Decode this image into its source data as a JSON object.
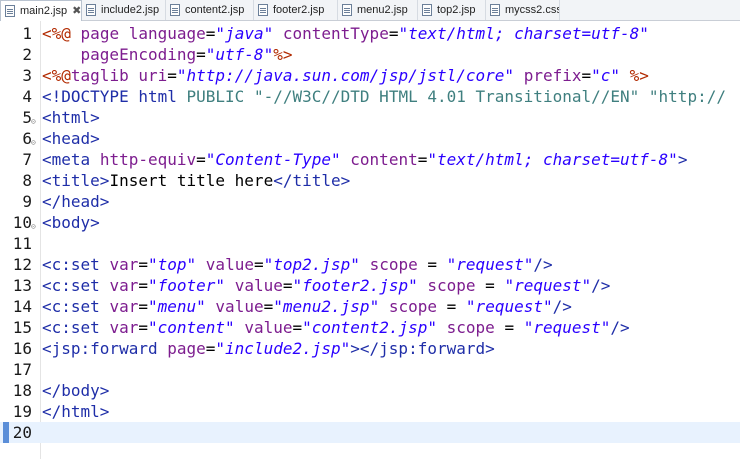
{
  "tabs": [
    {
      "label": "main2.jsp",
      "active": true,
      "closable": true
    },
    {
      "label": "include2.jsp"
    },
    {
      "label": "content2.jsp"
    },
    {
      "label": "footer2.jsp"
    },
    {
      "label": "menu2.jsp"
    },
    {
      "label": "top2.jsp"
    },
    {
      "label": "mycss2.css"
    }
  ],
  "editor": {
    "current_line": 20,
    "lines": [
      {
        "n": "1",
        "fold": false,
        "tokens": [
          [
            "dir",
            "<%@"
          ],
          [
            "plain",
            " "
          ],
          [
            "attr",
            "page"
          ],
          [
            "plain",
            " "
          ],
          [
            "attr",
            "language"
          ],
          [
            "plain",
            "="
          ],
          [
            "str",
            "\"java\""
          ],
          [
            "plain",
            " "
          ],
          [
            "attr",
            "contentType"
          ],
          [
            "plain",
            "="
          ],
          [
            "str",
            "\"text/html; charset=utf-8\""
          ]
        ]
      },
      {
        "n": "2",
        "fold": false,
        "tokens": [
          [
            "plain",
            "    "
          ],
          [
            "attr",
            "pageEncoding"
          ],
          [
            "plain",
            "="
          ],
          [
            "str",
            "\"utf-8\""
          ],
          [
            "dir",
            "%>"
          ]
        ]
      },
      {
        "n": "3",
        "fold": false,
        "tokens": [
          [
            "dir",
            "<%@"
          ],
          [
            "attr",
            "taglib"
          ],
          [
            "plain",
            " "
          ],
          [
            "attr",
            "uri"
          ],
          [
            "plain",
            "="
          ],
          [
            "str",
            "\"http://java.sun.com/jsp/jstl/core\""
          ],
          [
            "plain",
            " "
          ],
          [
            "attr",
            "prefix"
          ],
          [
            "plain",
            "="
          ],
          [
            "str",
            "\"c\""
          ],
          [
            "plain",
            " "
          ],
          [
            "dir",
            "%>"
          ]
        ]
      },
      {
        "n": "4",
        "fold": false,
        "tokens": [
          [
            "tag",
            "<!DOCTYPE"
          ],
          [
            "plain",
            " "
          ],
          [
            "tag",
            "html"
          ],
          [
            "plain",
            " "
          ],
          [
            "doc",
            "PUBLIC"
          ],
          [
            "plain",
            " "
          ],
          [
            "doc",
            "\"-//W3C//DTD HTML 4.01 Transitional//EN\""
          ],
          [
            "plain",
            " "
          ],
          [
            "doc",
            "\"http://"
          ]
        ]
      },
      {
        "n": "5",
        "fold": true,
        "tokens": [
          [
            "tag",
            "<html>"
          ]
        ]
      },
      {
        "n": "6",
        "fold": true,
        "tokens": [
          [
            "tag",
            "<head>"
          ]
        ]
      },
      {
        "n": "7",
        "fold": false,
        "tokens": [
          [
            "tag",
            "<meta"
          ],
          [
            "plain",
            " "
          ],
          [
            "attr",
            "http-equiv"
          ],
          [
            "plain",
            "="
          ],
          [
            "str",
            "\"Content-Type\""
          ],
          [
            "plain",
            " "
          ],
          [
            "attr",
            "content"
          ],
          [
            "plain",
            "="
          ],
          [
            "str",
            "\"text/html; charset=utf-8\""
          ],
          [
            "tag",
            ">"
          ]
        ]
      },
      {
        "n": "8",
        "fold": false,
        "tokens": [
          [
            "tag",
            "<title>"
          ],
          [
            "txt",
            "Insert title here"
          ],
          [
            "tag",
            "</title>"
          ]
        ]
      },
      {
        "n": "9",
        "fold": false,
        "tokens": [
          [
            "tag",
            "</head>"
          ]
        ]
      },
      {
        "n": "10",
        "fold": true,
        "tokens": [
          [
            "tag",
            "<body>"
          ]
        ]
      },
      {
        "n": "11",
        "fold": false,
        "tokens": []
      },
      {
        "n": "12",
        "fold": false,
        "tokens": [
          [
            "tag",
            "<c:set"
          ],
          [
            "plain",
            " "
          ],
          [
            "attr",
            "var"
          ],
          [
            "plain",
            "="
          ],
          [
            "str",
            "\"top\""
          ],
          [
            "plain",
            " "
          ],
          [
            "attr",
            "value"
          ],
          [
            "plain",
            "="
          ],
          [
            "str",
            "\"top2.jsp\""
          ],
          [
            "plain",
            " "
          ],
          [
            "attr",
            "scope"
          ],
          [
            "plain",
            " = "
          ],
          [
            "str",
            "\"request\""
          ],
          [
            "tag",
            "/>"
          ]
        ]
      },
      {
        "n": "13",
        "fold": false,
        "tokens": [
          [
            "tag",
            "<c:set"
          ],
          [
            "plain",
            " "
          ],
          [
            "attr",
            "var"
          ],
          [
            "plain",
            "="
          ],
          [
            "str",
            "\"footer\""
          ],
          [
            "plain",
            " "
          ],
          [
            "attr",
            "value"
          ],
          [
            "plain",
            "="
          ],
          [
            "str",
            "\"footer2.jsp\""
          ],
          [
            "plain",
            " "
          ],
          [
            "attr",
            "scope"
          ],
          [
            "plain",
            " = "
          ],
          [
            "str",
            "\"request\""
          ],
          [
            "tag",
            "/>"
          ]
        ]
      },
      {
        "n": "14",
        "fold": false,
        "tokens": [
          [
            "tag",
            "<c:set"
          ],
          [
            "plain",
            " "
          ],
          [
            "attr",
            "var"
          ],
          [
            "plain",
            "="
          ],
          [
            "str",
            "\"menu\""
          ],
          [
            "plain",
            " "
          ],
          [
            "attr",
            "value"
          ],
          [
            "plain",
            "="
          ],
          [
            "str",
            "\"menu2.jsp\""
          ],
          [
            "plain",
            " "
          ],
          [
            "attr",
            "scope"
          ],
          [
            "plain",
            " = "
          ],
          [
            "str",
            "\"request\""
          ],
          [
            "tag",
            "/>"
          ]
        ]
      },
      {
        "n": "15",
        "fold": false,
        "tokens": [
          [
            "tag",
            "<c:set"
          ],
          [
            "plain",
            " "
          ],
          [
            "attr",
            "var"
          ],
          [
            "plain",
            "="
          ],
          [
            "str",
            "\"content\""
          ],
          [
            "plain",
            " "
          ],
          [
            "attr",
            "value"
          ],
          [
            "plain",
            "="
          ],
          [
            "str",
            "\"content2.jsp\""
          ],
          [
            "plain",
            " "
          ],
          [
            "attr",
            "scope"
          ],
          [
            "plain",
            " = "
          ],
          [
            "str",
            "\"request\""
          ],
          [
            "tag",
            "/>"
          ]
        ]
      },
      {
        "n": "16",
        "fold": false,
        "tokens": [
          [
            "tag",
            "<jsp:forward"
          ],
          [
            "plain",
            " "
          ],
          [
            "attr",
            "page"
          ],
          [
            "plain",
            "="
          ],
          [
            "str",
            "\"include2.jsp\""
          ],
          [
            "tag",
            "></jsp:forward>"
          ]
        ]
      },
      {
        "n": "17",
        "fold": false,
        "tokens": []
      },
      {
        "n": "18",
        "fold": false,
        "tokens": [
          [
            "tag",
            "</body>"
          ]
        ]
      },
      {
        "n": "19",
        "fold": false,
        "tokens": [
          [
            "tag",
            "</html>"
          ]
        ]
      },
      {
        "n": "20",
        "fold": false,
        "tokens": []
      }
    ]
  }
}
